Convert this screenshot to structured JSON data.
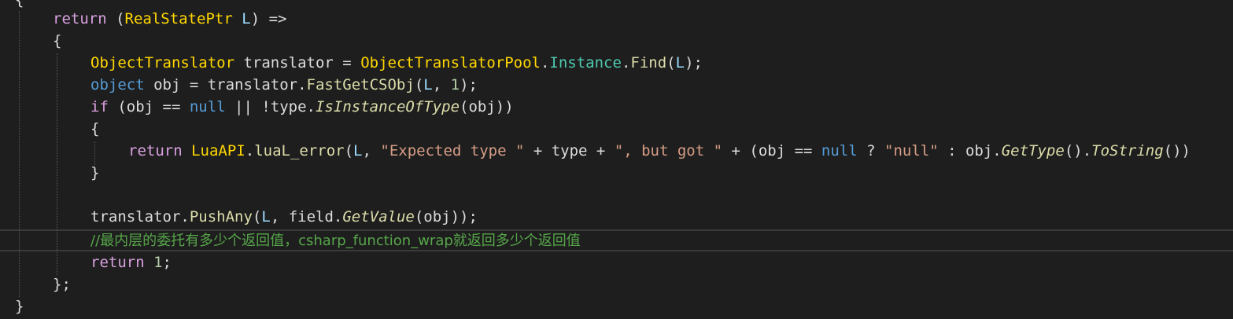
{
  "editor": {
    "lines": [
      {
        "id": "l0",
        "tokens": [
          {
            "t": "{",
            "c": "punc"
          }
        ]
      },
      {
        "id": "l1",
        "tokens": [
          {
            "t": "return",
            "c": "ctl"
          },
          {
            "t": " (",
            "c": "punc"
          },
          {
            "t": "RealStatePtr",
            "c": "type"
          },
          {
            "t": " ",
            "c": "punc"
          },
          {
            "t": "L",
            "c": "par"
          },
          {
            "t": ") =>",
            "c": "punc"
          }
        ]
      },
      {
        "id": "l2",
        "tokens": [
          {
            "t": "{",
            "c": "punc"
          }
        ]
      },
      {
        "id": "l3",
        "tokens": [
          {
            "t": "ObjectTranslator",
            "c": "type"
          },
          {
            "t": " translator = ",
            "c": "local"
          },
          {
            "t": "ObjectTranslatorPool",
            "c": "type"
          },
          {
            "t": ".",
            "c": "punc"
          },
          {
            "t": "Instance",
            "c": "cls"
          },
          {
            "t": ".",
            "c": "punc"
          },
          {
            "t": "Find",
            "c": "mth"
          },
          {
            "t": "(",
            "c": "punc"
          },
          {
            "t": "L",
            "c": "par"
          },
          {
            "t": ");",
            "c": "punc"
          }
        ]
      },
      {
        "id": "l4",
        "tokens": [
          {
            "t": "object",
            "c": "kw"
          },
          {
            "t": " obj = translator.",
            "c": "local"
          },
          {
            "t": "FastGetCSObj",
            "c": "mth"
          },
          {
            "t": "(",
            "c": "punc"
          },
          {
            "t": "L",
            "c": "par"
          },
          {
            "t": ", ",
            "c": "punc"
          },
          {
            "t": "1",
            "c": "num"
          },
          {
            "t": ");",
            "c": "punc"
          }
        ]
      },
      {
        "id": "l5",
        "tokens": [
          {
            "t": "if",
            "c": "ctl"
          },
          {
            "t": " (obj == ",
            "c": "local"
          },
          {
            "t": "null",
            "c": "kw"
          },
          {
            "t": " || !type.",
            "c": "local"
          },
          {
            "t": "IsInstanceOfType",
            "c": "ext"
          },
          {
            "t": "(obj))",
            "c": "punc"
          }
        ]
      },
      {
        "id": "l6",
        "tokens": [
          {
            "t": "{",
            "c": "punc"
          }
        ]
      },
      {
        "id": "l7",
        "tokens": [
          {
            "t": "return",
            "c": "ctl"
          },
          {
            "t": " ",
            "c": "punc"
          },
          {
            "t": "LuaAPI",
            "c": "type"
          },
          {
            "t": ".",
            "c": "punc"
          },
          {
            "t": "luaL_error",
            "c": "mth"
          },
          {
            "t": "(",
            "c": "punc"
          },
          {
            "t": "L",
            "c": "par"
          },
          {
            "t": ", ",
            "c": "punc"
          },
          {
            "t": "\"Expected type \"",
            "c": "str"
          },
          {
            "t": " + type + ",
            "c": "local"
          },
          {
            "t": "\", but got \"",
            "c": "str"
          },
          {
            "t": " + (obj == ",
            "c": "local"
          },
          {
            "t": "null",
            "c": "kw"
          },
          {
            "t": " ? ",
            "c": "punc"
          },
          {
            "t": "\"null\"",
            "c": "str"
          },
          {
            "t": " : obj.",
            "c": "local"
          },
          {
            "t": "GetType",
            "c": "ext"
          },
          {
            "t": "().",
            "c": "punc"
          },
          {
            "t": "ToString",
            "c": "ext"
          },
          {
            "t": "())",
            "c": "punc"
          }
        ]
      },
      {
        "id": "l8",
        "tokens": [
          {
            "t": "}",
            "c": "punc"
          }
        ]
      },
      {
        "id": "l9",
        "tokens": []
      },
      {
        "id": "l10",
        "tokens": [
          {
            "t": "translator.",
            "c": "local"
          },
          {
            "t": "PushAny",
            "c": "mth"
          },
          {
            "t": "(",
            "c": "punc"
          },
          {
            "t": "L",
            "c": "par"
          },
          {
            "t": ", field.",
            "c": "local"
          },
          {
            "t": "GetValue",
            "c": "ext"
          },
          {
            "t": "(obj));",
            "c": "punc"
          }
        ]
      },
      {
        "id": "l11",
        "tokens": [
          {
            "t": "//最内层的委托有多少个返回值，csharp_function_wrap就返回多少个返回值",
            "c": "cmt"
          }
        ]
      },
      {
        "id": "l12",
        "tokens": [
          {
            "t": "return",
            "c": "ctl"
          },
          {
            "t": " ",
            "c": "punc"
          },
          {
            "t": "1",
            "c": "num"
          },
          {
            "t": ";",
            "c": "punc"
          }
        ]
      },
      {
        "id": "l13",
        "tokens": [
          {
            "t": "};",
            "c": "punc"
          }
        ]
      },
      {
        "id": "l14",
        "tokens": [
          {
            "t": "}",
            "c": "punc"
          }
        ]
      }
    ]
  }
}
